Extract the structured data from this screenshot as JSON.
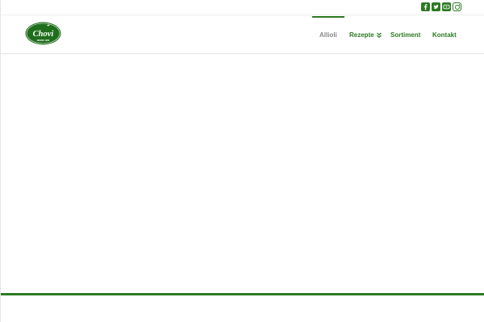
{
  "social": {
    "icons": [
      "facebook-icon",
      "twitter-icon",
      "youtube-icon",
      "instagram-icon"
    ],
    "color": "#2b7a22"
  },
  "logo": {
    "text": "Chovi",
    "subtext": "DESDE 1960",
    "color": "#1f6e1c"
  },
  "nav": {
    "items": [
      {
        "label": "Allioli",
        "active": true
      },
      {
        "label": "Rezepte",
        "has_dropdown": true
      },
      {
        "label": "Sortiment"
      },
      {
        "label": "Kontakt"
      }
    ]
  },
  "colors": {
    "accent": "#2b7a22",
    "inactive": "#888888",
    "headline": "#e8d21c"
  }
}
